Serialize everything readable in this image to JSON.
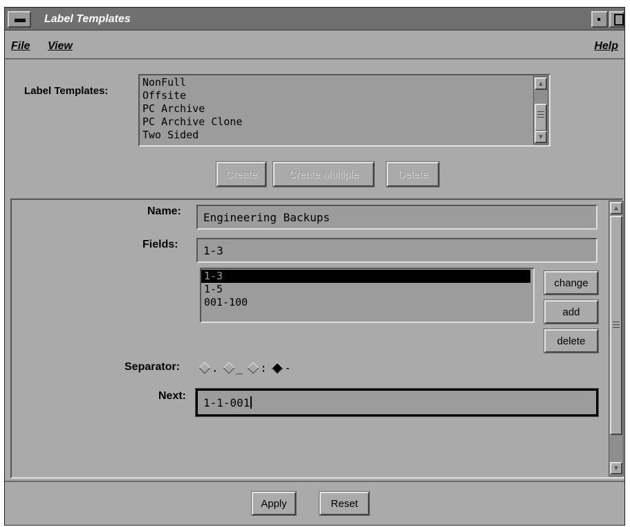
{
  "window": {
    "title": "Label Templates"
  },
  "menubar": {
    "file": "File",
    "view": "View",
    "help": "Help"
  },
  "templates": {
    "label": "Label Templates:",
    "items": [
      "NonFull",
      "Offsite",
      "PC Archive",
      "PC Archive Clone",
      "Two Sided"
    ],
    "buttons": {
      "create": "Create",
      "create_multiple": "Create Multiple",
      "delete": "Delete"
    }
  },
  "form": {
    "name_label": "Name:",
    "name_value": "Engineering Backups",
    "fields_label": "Fields:",
    "fields_value": "1-3",
    "field_list": [
      "1-3",
      "1-5",
      "001-100"
    ],
    "field_list_selected": "1-3",
    "field_buttons": {
      "change": "change",
      "add": "add",
      "delete": "delete"
    },
    "separator_label": "Separator:",
    "separator_options": [
      ".",
      "_",
      ":",
      "-"
    ],
    "separator_selected": "-",
    "next_label": "Next:",
    "next_value": "1-1-001"
  },
  "footer": {
    "apply": "Apply",
    "reset": "Reset"
  }
}
